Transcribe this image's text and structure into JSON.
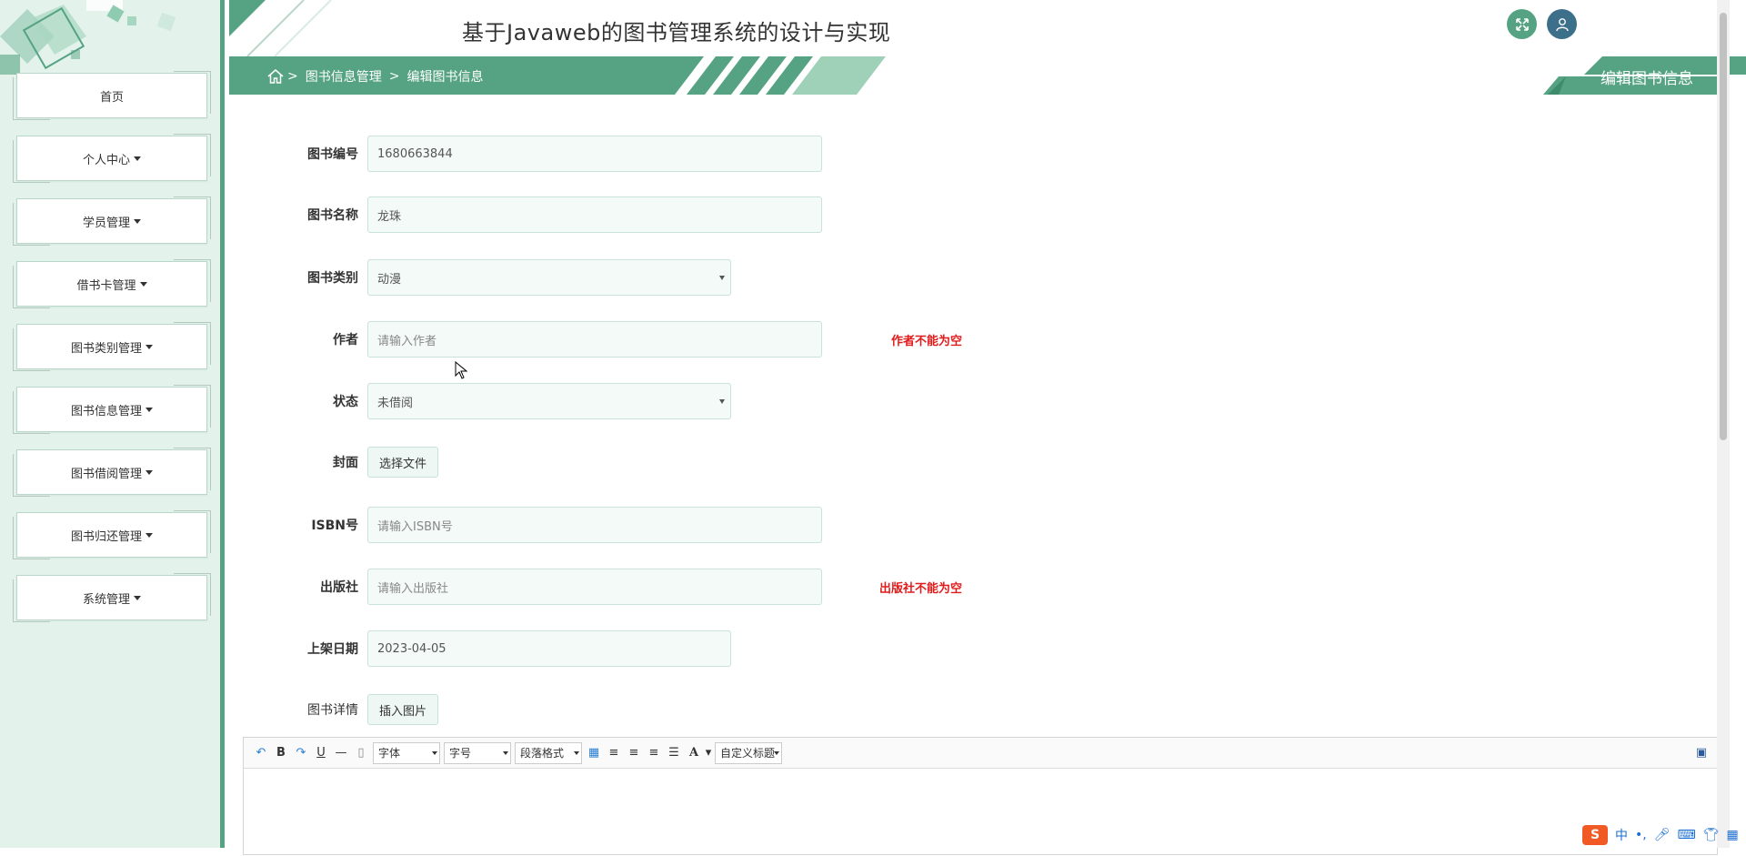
{
  "app": {
    "title": "基于Javaweb的图书管理系统的设计与实现"
  },
  "colors": {
    "accent": "#55a382",
    "sidebar_bg": "#e3f3ec",
    "error": "#e01b1b",
    "user_button": "#3c6f8a"
  },
  "sidebar": {
    "items": [
      {
        "label": "首页",
        "dropdown": false
      },
      {
        "label": "个人中心",
        "dropdown": true
      },
      {
        "label": "学员管理",
        "dropdown": true
      },
      {
        "label": "借书卡管理",
        "dropdown": true
      },
      {
        "label": "图书类别管理",
        "dropdown": true
      },
      {
        "label": "图书信息管理",
        "dropdown": true
      },
      {
        "label": "图书借阅管理",
        "dropdown": true
      },
      {
        "label": "图书归还管理",
        "dropdown": true
      },
      {
        "label": "系统管理",
        "dropdown": true
      }
    ]
  },
  "header": {
    "icons": [
      "expand-icon",
      "user-icon"
    ]
  },
  "breadcrumb": {
    "home_icon": "home-icon",
    "sep": ">",
    "items": [
      "图书信息管理",
      "编辑图书信息"
    ]
  },
  "page_heading": "编辑图书信息",
  "form": {
    "book_no": {
      "label": "图书编号",
      "value": "1680663844"
    },
    "book_name": {
      "label": "图书名称",
      "value": "龙珠"
    },
    "category": {
      "label": "图书类别",
      "value": "动漫"
    },
    "author": {
      "label": "作者",
      "placeholder": "请输入作者",
      "error": "作者不能为空"
    },
    "status": {
      "label": "状态",
      "value": "未借阅"
    },
    "cover": {
      "label": "封面",
      "button": "选择文件"
    },
    "isbn": {
      "label": "ISBN号",
      "placeholder": "请输入ISBN号"
    },
    "publisher": {
      "label": "出版社",
      "placeholder": "请输入出版社",
      "error": "出版社不能为空"
    },
    "shelf_date": {
      "label": "上架日期",
      "value": "2023-04-05"
    },
    "details": {
      "label": "图书详情",
      "button": "插入图片"
    }
  },
  "editor": {
    "toolbar": {
      "bold": "B",
      "underline": "U",
      "font_family": "字体",
      "font_size": "字号",
      "paragraph": "段落格式",
      "font_color": "A",
      "custom_title": "自定义标题"
    }
  },
  "ime": {
    "logo": "S",
    "mode": "中",
    "punct": "•,"
  }
}
